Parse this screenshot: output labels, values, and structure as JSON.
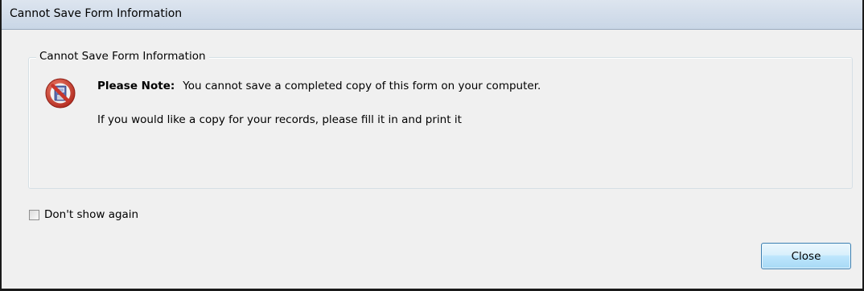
{
  "window": {
    "title": "Cannot Save Form Information"
  },
  "group": {
    "legend": "Cannot Save Form Information"
  },
  "message": {
    "icon": "no-save-prohibited-icon",
    "note_label": "Please Note:",
    "note_text": "You cannot save a completed copy of this form on your computer.",
    "secondary_text": "If you would like a copy for your records, please fill it in and print it"
  },
  "options": {
    "dont_show_again_label": "Don't show again",
    "dont_show_again_checked": false
  },
  "buttons": {
    "close_label": "Close"
  },
  "colors": {
    "accent": "#3c7fb1",
    "icon_red": "#c8362b",
    "icon_blue": "#5b6fb0"
  }
}
